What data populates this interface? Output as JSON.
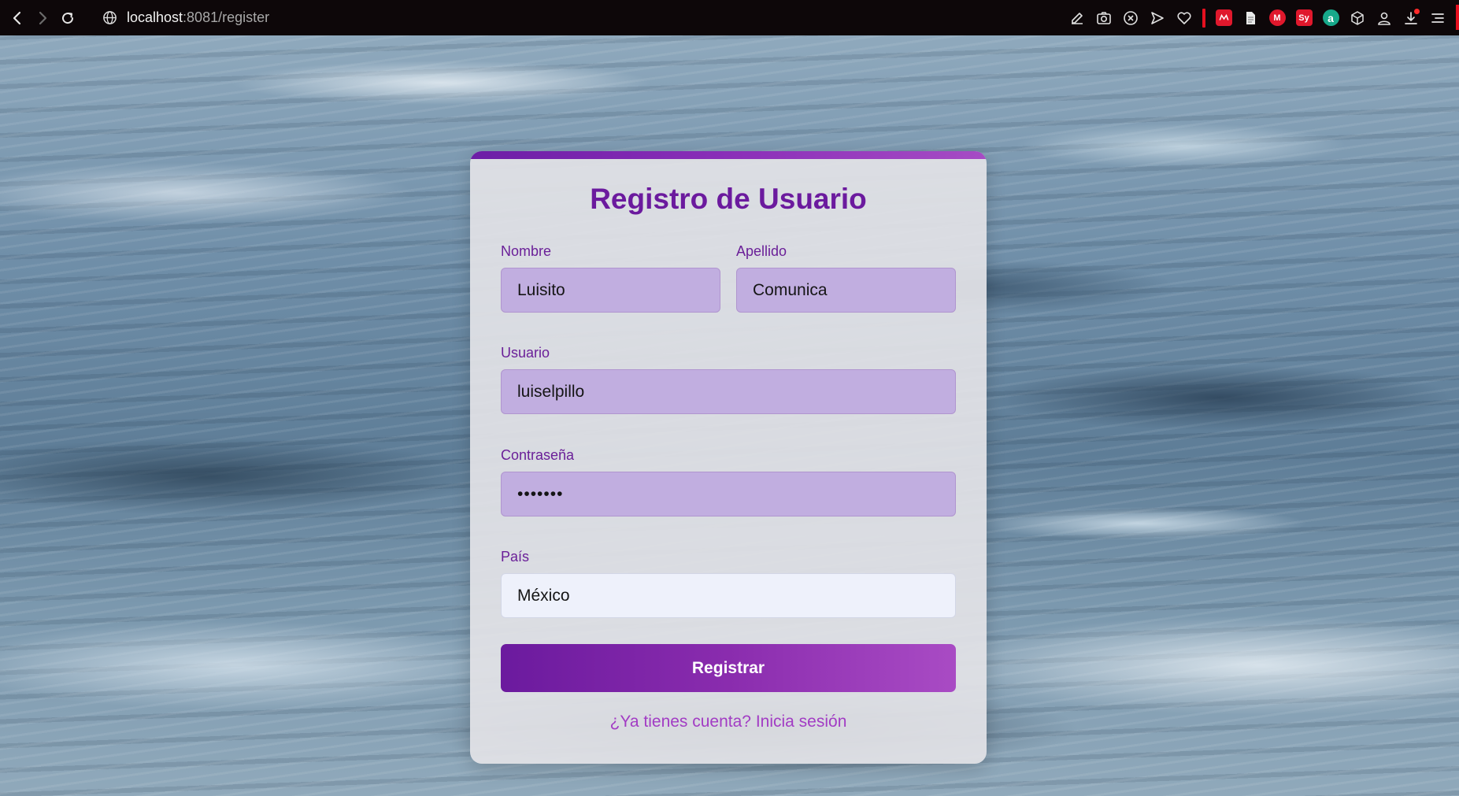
{
  "browser": {
    "url_host": "localhost",
    "url_rest": ":8081/register",
    "nav": {
      "back_icon": "chevron-left-icon",
      "forward_icon": "chevron-right-icon",
      "reload_icon": "reload-icon",
      "site_icon": "globe-icon"
    },
    "toolbar_icons": [
      "edit-icon",
      "camera-icon",
      "close-circle-icon",
      "send-icon",
      "heart-icon",
      "extension-icon",
      "document-icon",
      "extension-icon",
      "extension-icon",
      "extension-icon",
      "cube-icon",
      "profile-icon",
      "download-icon",
      "menu-icon"
    ],
    "extensions": {
      "sy_label": "Sy",
      "a_label": "a",
      "m_label": "M"
    }
  },
  "form": {
    "title": "Registro de Usuario",
    "nombre": {
      "label": "Nombre",
      "value": "Luisito"
    },
    "apellido": {
      "label": "Apellido",
      "value": "Comunica"
    },
    "usuario": {
      "label": "Usuario",
      "value": "luiselpillo"
    },
    "password": {
      "label": "Contraseña",
      "value_masked": "•••••••"
    },
    "pais": {
      "label": "País",
      "value": "México"
    },
    "submit_label": "Registrar",
    "login_link": "¿Ya tienes cuenta? Inicia sesión"
  },
  "colors": {
    "accent": "#6b1a9e",
    "input_bg": "#c1aee0",
    "link": "#a23cc4"
  }
}
